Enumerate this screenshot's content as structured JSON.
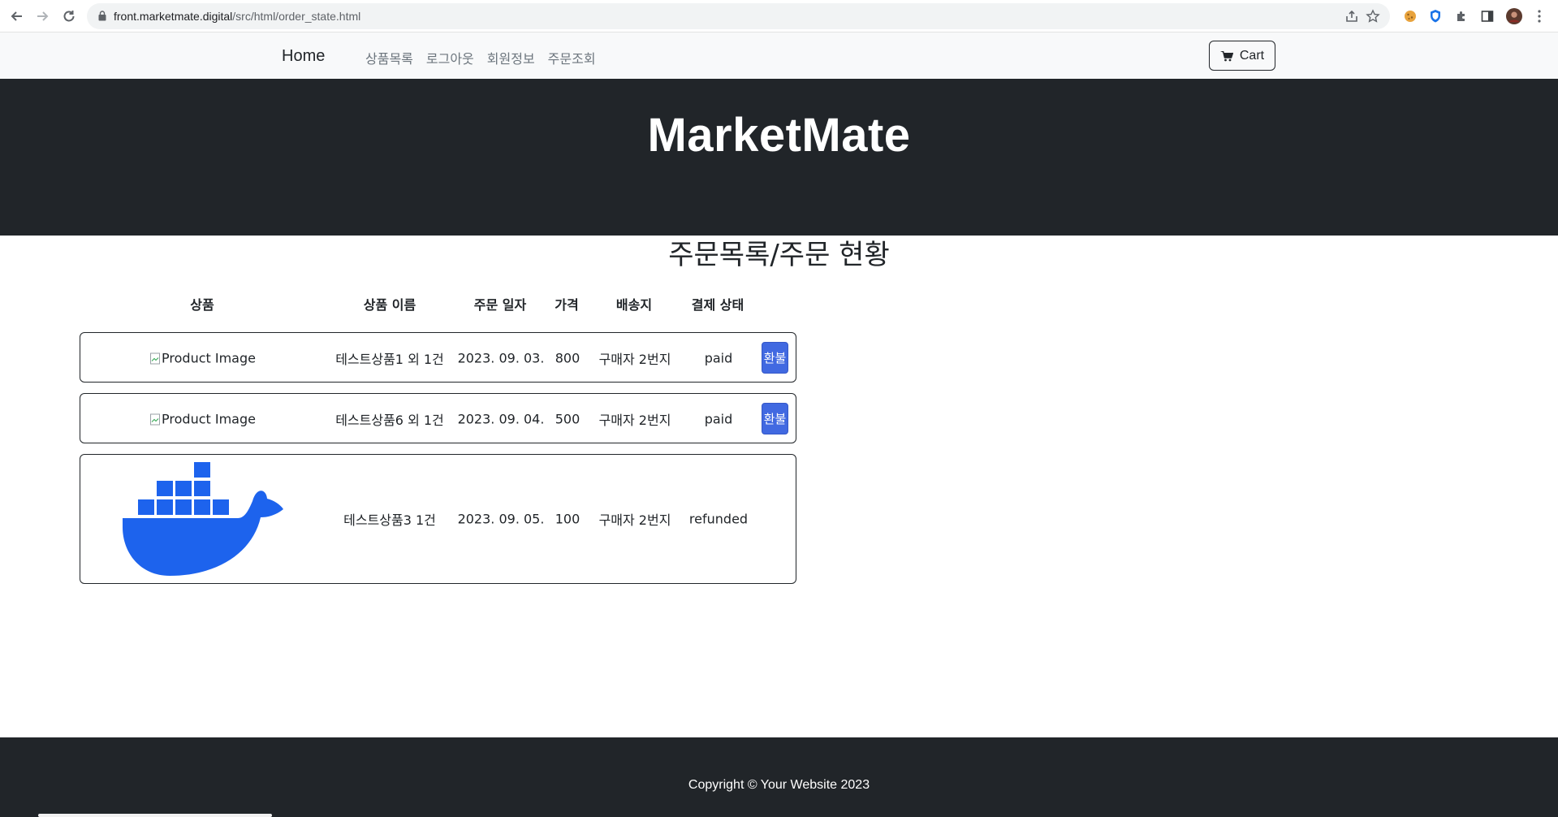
{
  "browser": {
    "url_host": "front.marketmate.digital",
    "url_path": "/src/html/order_state.html"
  },
  "nav": {
    "brand": "Home",
    "links": [
      "상품목록",
      "로그아웃",
      "회원정보",
      "주문조회"
    ],
    "cart_label": "Cart"
  },
  "hero": {
    "title": "MarketMate"
  },
  "orders_section": {
    "title": "주문목록/주문 현황",
    "headers": [
      "상품",
      "상품 이름",
      "주문 일자",
      "가격",
      "배송지",
      "결제 상태"
    ],
    "rows": [
      {
        "image_alt": "Product Image",
        "name": "테스트상품1 외 1건",
        "date": "2023. 09. 03.",
        "price": "800",
        "address": "구매자 2번지",
        "status": "paid",
        "refund_label": "환불"
      },
      {
        "image_alt": "Product Image",
        "name": "테스트상품6 외 1건",
        "date": "2023. 09. 04.",
        "price": "500",
        "address": "구매자 2번지",
        "status": "paid",
        "refund_label": "환불"
      },
      {
        "image_icon": "docker-whale-icon",
        "name": "테스트상품3 1건",
        "date": "2023. 09. 05.",
        "price": "100",
        "address": "구매자 2번지",
        "status": "refunded"
      }
    ]
  },
  "footer": {
    "copyright": "Copyright © Your Website 2023"
  },
  "colors": {
    "dark": "#212529",
    "nav_bg": "#f8f9fa",
    "refund_button": "#4169e1",
    "docker_blue": "#1d63ed"
  }
}
